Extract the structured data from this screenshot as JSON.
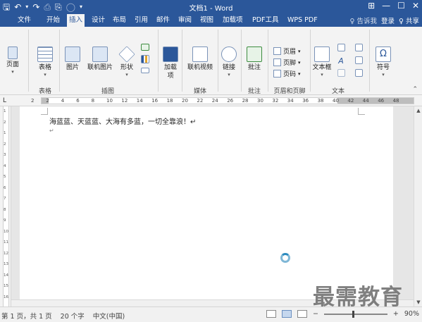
{
  "titlebar": {
    "title": "文档1 - Word",
    "qat": {
      "save": "🖫",
      "undo": "↶",
      "undo_caret": "▾",
      "redo": "↷",
      "quick_print": "⎙",
      "preview": "⎘",
      "touch": "◯",
      "customize": "▾"
    },
    "window": {
      "restore_ribbon": "⊞",
      "minimize": "—",
      "maximize": "☐",
      "close": "✕"
    }
  },
  "tabs": [
    {
      "label": "文件"
    },
    {
      "label": "开始"
    },
    {
      "label": "插入"
    },
    {
      "label": "设计"
    },
    {
      "label": "布局"
    },
    {
      "label": "引用"
    },
    {
      "label": "邮件"
    },
    {
      "label": "审阅"
    },
    {
      "label": "视图"
    },
    {
      "label": "加载项"
    },
    {
      "label": "PDF工具"
    },
    {
      "label": "WPS PDF"
    }
  ],
  "tabrow_right": {
    "tell_me": "♀ 告诉我",
    "login": "登录",
    "share": "♀ 共享"
  },
  "ribbon": {
    "pages_btn": "页面",
    "table_btn": "表格",
    "picture_btn": "图片",
    "online_picture_btn": "联机图片",
    "shapes_btn": "形状",
    "addins_btn": "加载",
    "addins_btn_line2": "项",
    "online_video_btn": "联机视频",
    "link_btn": "链接",
    "comment_btn": "批注",
    "header_btn": "页眉",
    "footer_btn": "页脚",
    "page_number_btn": "页码",
    "textbox_btn": "文本框",
    "symbol_btn": "符号",
    "groups": {
      "tables": "表格",
      "illustrations": "插图",
      "media": "媒体",
      "comments": "批注",
      "header_footer": "页眉和页脚",
      "text": "文本"
    }
  },
  "ruler": {
    "corner": "L",
    "ticks": [
      "2",
      "2",
      "4",
      "6",
      "8",
      "10",
      "12",
      "14",
      "16",
      "18",
      "20",
      "22",
      "24",
      "26",
      "28",
      "30",
      "32",
      "34",
      "36",
      "38",
      "40",
      "42",
      "44",
      "46",
      "48"
    ],
    "vticks": [
      "1",
      "2",
      "1",
      "2",
      "3",
      "4",
      "5",
      "6",
      "7",
      "8",
      "9",
      "10",
      "11",
      "12",
      "13",
      "14",
      "15",
      "16"
    ]
  },
  "document": {
    "line1": "海蓝蓝、天蓝蓝、大海有多蓝，一切全靠浪！↵",
    "para_mark": "↵"
  },
  "statusbar": {
    "page": "第 1 页，共 1 页",
    "words": "20 个字",
    "language": "中文(中国)",
    "zoom_minus": "−",
    "zoom_plus": "+",
    "zoom": "90%"
  },
  "watermark": "最需教育"
}
